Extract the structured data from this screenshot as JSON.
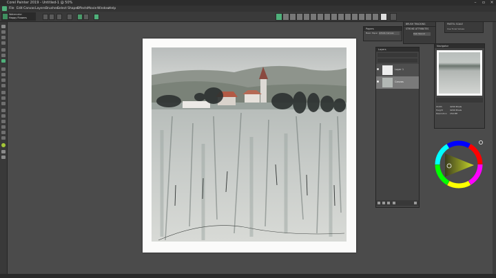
{
  "window": {
    "title": "Corel Painter 2019 - Untitled-1 @ 50%"
  },
  "menu": {
    "items": [
      "File",
      "Edit",
      "Canvas",
      "Layers",
      "Brushes",
      "Select",
      "Shapes",
      "Effects",
      "Movie",
      "Window",
      "Help"
    ]
  },
  "brush_selector": {
    "category": "Watercolor",
    "variant": "Happy Flowers"
  },
  "panels": {
    "brush_tracking": "BRUSH TRACKING",
    "pastel_scale": "PASTEL SCALE",
    "stroke_attributes": "STROKE ATTRIBUTES",
    "papers_tab": "Papers",
    "papers_item": "Basic Paper",
    "paper_name": "Artists Canvas",
    "layers_tab": "Layers",
    "layer_1": "Layer 1",
    "layer_canvas": "Canvas",
    "navigator_tab": "Navigator",
    "nav_info": [
      "Width",
      "Height",
      "Resolution"
    ],
    "nav_values": [
      "4200 Pixels",
      "4200 Pixels",
      "150 PPI"
    ],
    "scale_label": "Use Tonal Values",
    "coating_label": "Dab Stencil"
  },
  "colors": {
    "accent": "#4fb07a",
    "app_bg": "#4b4b4b"
  }
}
